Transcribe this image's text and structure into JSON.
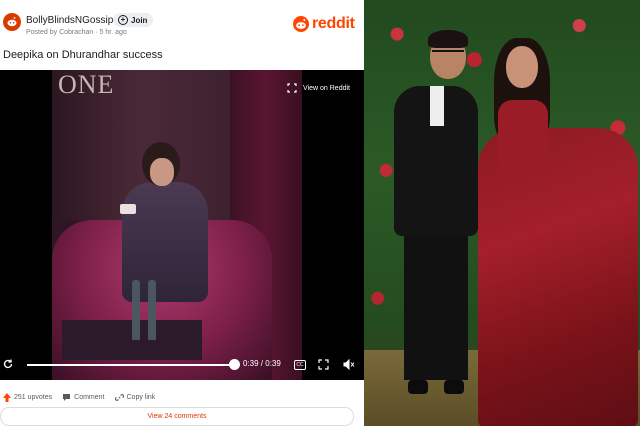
{
  "colors": {
    "reddit_orange": "#ff4500",
    "link_orange": "#d93a00"
  },
  "card": {
    "subreddit": "BollyBlindsNGossip",
    "join_label": "Join",
    "posted_by": "Posted by Cobrachan · 5 hr. ago",
    "brand": "reddit",
    "post_title": "Deepika on Dhurandhar success"
  },
  "video": {
    "overlay_text": "ONE",
    "view_on_reddit": "View on Reddit",
    "time": "0:39 / 0:39",
    "progress": 1.0,
    "cc_label": "CC"
  },
  "actions": {
    "upvotes": "251 upvotes",
    "comment": "Comment",
    "copy_link": "Copy link",
    "view_comments": "View 24 comments"
  },
  "icons": [
    "reddit-alien-icon",
    "plus-icon",
    "expand-icon",
    "replay-icon",
    "fullscreen-icon",
    "mute-icon",
    "upvote-icon",
    "comment-icon",
    "link-icon"
  ]
}
